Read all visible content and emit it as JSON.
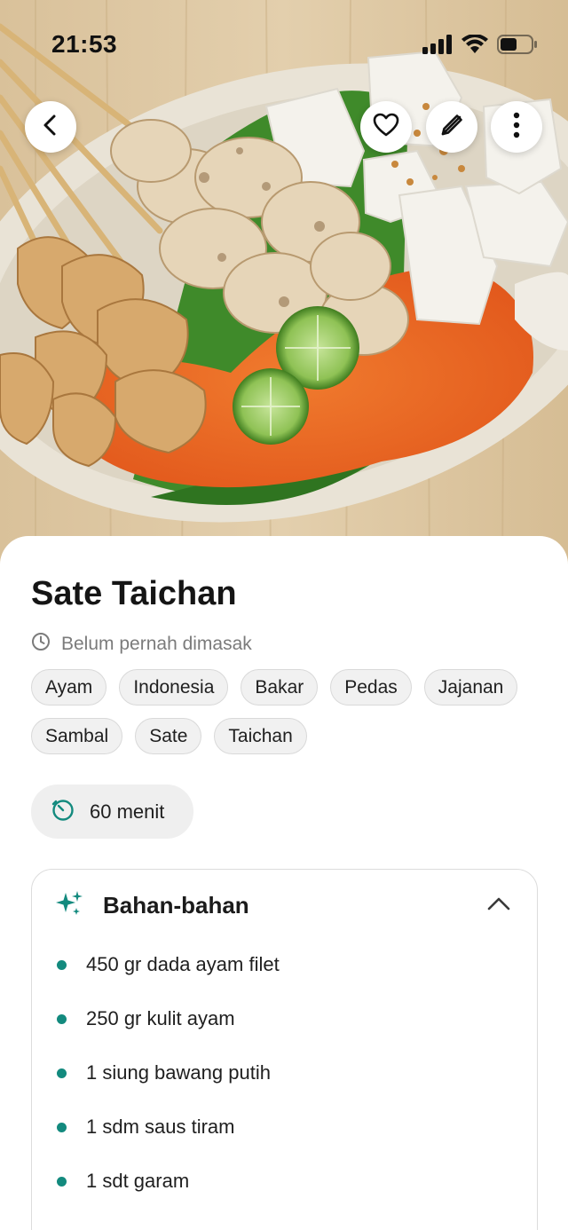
{
  "status_bar": {
    "time": "21:53",
    "icons": [
      "signal-icon",
      "wifi-icon",
      "battery-icon"
    ]
  },
  "hero": {
    "image": "satay-plate-photo"
  },
  "actions": {
    "back_icon": "chevron-left-icon",
    "favorite_icon": "heart-icon",
    "edit_icon": "pencil-icon",
    "more_icon": "more-vertical-icon"
  },
  "recipe": {
    "title": "Sate Taichan",
    "cooked_status": "Belum pernah dimasak",
    "tags": [
      "Ayam",
      "Indonesia",
      "Bakar",
      "Pedas",
      "Jajanan",
      "Sambal",
      "Sate",
      "Taichan"
    ],
    "duration": "60 menit"
  },
  "ingredients": {
    "header": "Bahan-bahan",
    "items": [
      "450 gr dada ayam filet",
      "250 gr kulit ayam",
      "1 siung bawang putih",
      "1 sdm saus tiram",
      "1 sdt garam"
    ]
  },
  "colors": {
    "accent": "#138a7e",
    "chip_bg": "#f1f1f1",
    "chip_border": "#d9d9d9",
    "muted_text": "#7b7b7b"
  }
}
